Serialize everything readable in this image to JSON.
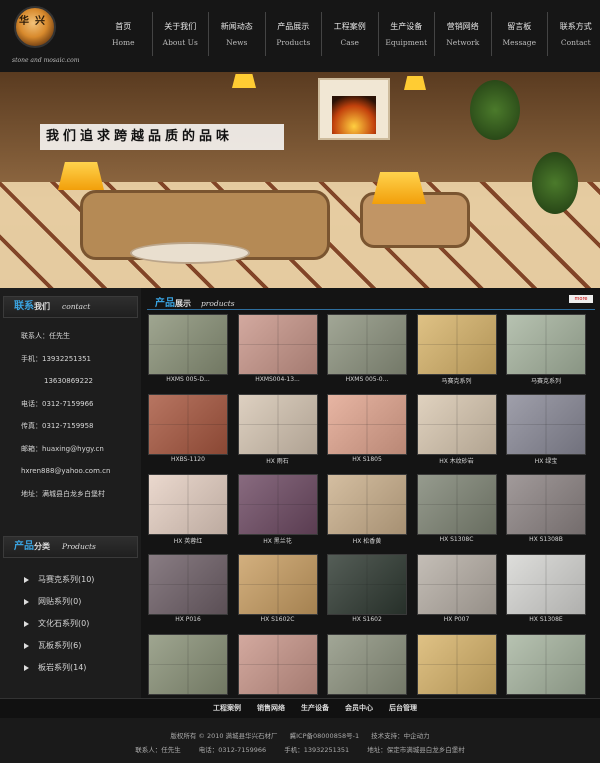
{
  "brand": {
    "logo_text": "华兴",
    "tagline": "stone and mosaic.com"
  },
  "nav": [
    {
      "cn": "首页",
      "en": "Home"
    },
    {
      "cn": "关于我们",
      "en": "About Us"
    },
    {
      "cn": "新闻动态",
      "en": "News"
    },
    {
      "cn": "产品展示",
      "en": "Products"
    },
    {
      "cn": "工程案例",
      "en": "Case"
    },
    {
      "cn": "生产设备",
      "en": "Equipment"
    },
    {
      "cn": "营销网络",
      "en": "Network"
    },
    {
      "cn": "留言板",
      "en": "Message"
    },
    {
      "cn": "联系方式",
      "en": "Contact"
    }
  ],
  "banner": {
    "slogan": "我们追求跨越品质的品味"
  },
  "contact": {
    "title_hl": "联系",
    "title_rest": "我们",
    "title_en": "contact",
    "lines": [
      "联系人：任先生",
      "手机：13932251351",
      "13630869222",
      "电话：0312-7159966",
      "传真：0312-7159958",
      "邮箱：huaxing@hygy.cn",
      "hxren888@yahoo.com.cn",
      "地址：满城县白龙乡白堡村"
    ]
  },
  "categories": {
    "title_hl": "产品",
    "title_rest": "分类",
    "title_en": "Products",
    "items": [
      "马赛克系列(10)",
      "网贴系列(0)",
      "文化石系列(0)",
      "瓦板系列(6)",
      "板岩系列(14)"
    ]
  },
  "products": {
    "title_hl": "产品",
    "title_rest": "展示",
    "title_en": "products",
    "more_label": "more",
    "items": [
      {
        "caption": "HXMS 005-D...",
        "color": "#8a9278"
      },
      {
        "caption": "HXMS004-13...",
        "color": "#c9968a"
      },
      {
        "caption": "HXMS 005-0...",
        "color": "#8d937f"
      },
      {
        "caption": "马赛克系列",
        "color": "#d8b46a"
      },
      {
        "caption": "马赛克系列",
        "color": "#a7b5a0"
      },
      {
        "caption": "HXBS-1120",
        "color": "#a8573f"
      },
      {
        "caption": "HX 雨石",
        "color": "#d6c6b3"
      },
      {
        "caption": "HX S1805",
        "color": "#e2a58f"
      },
      {
        "caption": "HX 木纹砂岩",
        "color": "#d9c8b1"
      },
      {
        "caption": "HX 绿宝",
        "color": "#8a8a98"
      },
      {
        "caption": "HX 英蓉红",
        "color": "#e6d0c3"
      },
      {
        "caption": "HX 黑兰花",
        "color": "#6e4a63"
      },
      {
        "caption": "HX 松香黄",
        "color": "#cbb08c"
      },
      {
        "caption": "HX S1308C",
        "color": "#7f8575"
      },
      {
        "caption": "HX S1308B",
        "color": "#8d8484"
      },
      {
        "caption": "HX P016",
        "color": "#6f6068"
      },
      {
        "caption": "HX S1602C",
        "color": "#c99e62"
      },
      {
        "caption": "HX S1602",
        "color": "#2f3a32"
      },
      {
        "caption": "HX P007",
        "color": "#b7afa6"
      },
      {
        "caption": "HX S1308E",
        "color": "#d6d6d3"
      },
      {
        "caption": "",
        "color": "#8a9278"
      },
      {
        "caption": "",
        "color": "#c9968a"
      },
      {
        "caption": "",
        "color": "#8d937f"
      },
      {
        "caption": "",
        "color": "#d8b46a"
      },
      {
        "caption": "",
        "color": "#a7b5a0"
      }
    ]
  },
  "footer_nav": [
    "工程案例",
    "销售网络",
    "生产设备",
    "会员中心",
    "后台管理"
  ],
  "footer": {
    "copyright": "版权所有 © 2010 满城县华兴石材厂",
    "icp": "冀ICP备08000858号-1",
    "support": "技术支持：中企动力",
    "contact": "联系人：任先生",
    "tel": "电话：0312-7159966",
    "mobile": "手机：13932251351",
    "address": "地址：保定市满城县白龙乡白堡村"
  }
}
